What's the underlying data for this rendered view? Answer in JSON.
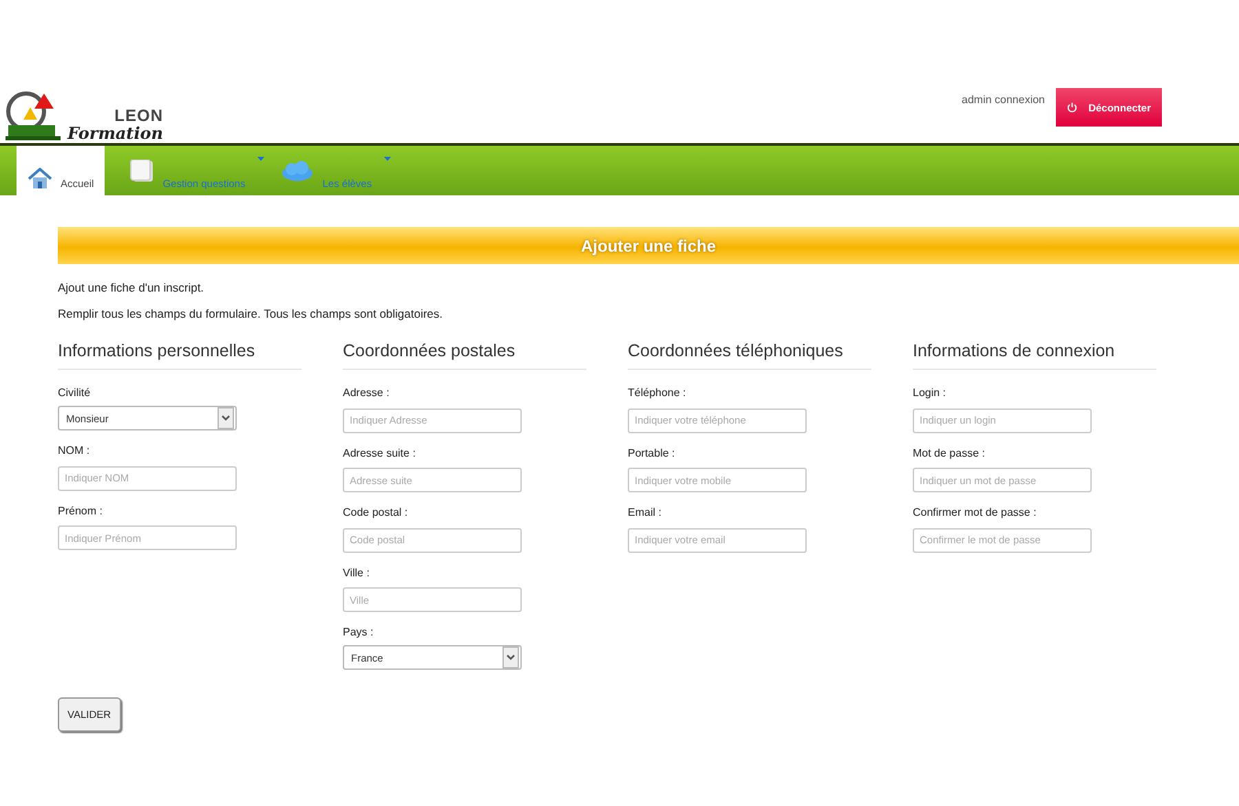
{
  "header": {
    "logo": {
      "line1": "LEON",
      "line2": "Formation"
    },
    "user": "admin connexion",
    "logout_button": "Déconnecter"
  },
  "nav": [
    {
      "label": "Accueil",
      "selected": true,
      "dropdown": false
    },
    {
      "label": "Gestion questions",
      "selected": false,
      "dropdown": true
    },
    {
      "label": "Les élèves",
      "selected": false,
      "dropdown": true
    }
  ],
  "banner": "Ajouter une fiche",
  "intro": [
    "Ajout une fiche d'un inscript.",
    "Remplir tous les champs du formulaire. Tous les champs sont obligatoires."
  ],
  "sections": [
    {
      "title": "Informations personnelles",
      "fields": [
        {
          "label": "Civilité",
          "kind": "select",
          "value": "Monsieur"
        },
        {
          "label": "NOM :",
          "kind": "text",
          "placeholder": "Indiquer NOM"
        },
        {
          "label": "Prénom :",
          "kind": "text",
          "placeholder": "Indiquer Prénom"
        }
      ]
    },
    {
      "title": "Coordonnées postales",
      "fields": [
        {
          "label": "Adresse :",
          "kind": "text",
          "placeholder": "Indiquer Adresse"
        },
        {
          "label": "Adresse suite :",
          "kind": "text",
          "placeholder": "Adresse suite"
        },
        {
          "label": "Code postal :",
          "kind": "text",
          "placeholder": "Code postal"
        },
        {
          "label": "Ville :",
          "kind": "text",
          "placeholder": "Ville"
        },
        {
          "label": "Pays :",
          "kind": "select",
          "value": "France"
        }
      ]
    },
    {
      "title": "Coordonnées téléphoniques",
      "fields": [
        {
          "label": "Téléphone :",
          "kind": "text",
          "placeholder": "Indiquer votre téléphone"
        },
        {
          "label": "Portable :",
          "kind": "text",
          "placeholder": "Indiquer votre mobile"
        },
        {
          "label": "Email :",
          "kind": "text",
          "placeholder": "Indiquer votre email"
        }
      ]
    },
    {
      "title": "Informations de connexion",
      "fields": [
        {
          "label": "Login :",
          "kind": "text",
          "placeholder": "Indiquer un login"
        },
        {
          "label": "Mot de passe :",
          "kind": "text",
          "placeholder": "Indiquer un mot de passe"
        },
        {
          "label": "Confirmer mot de passe :",
          "kind": "text",
          "placeholder": "Confirmer le mot de passe"
        }
      ]
    }
  ],
  "submit": "VALIDER"
}
